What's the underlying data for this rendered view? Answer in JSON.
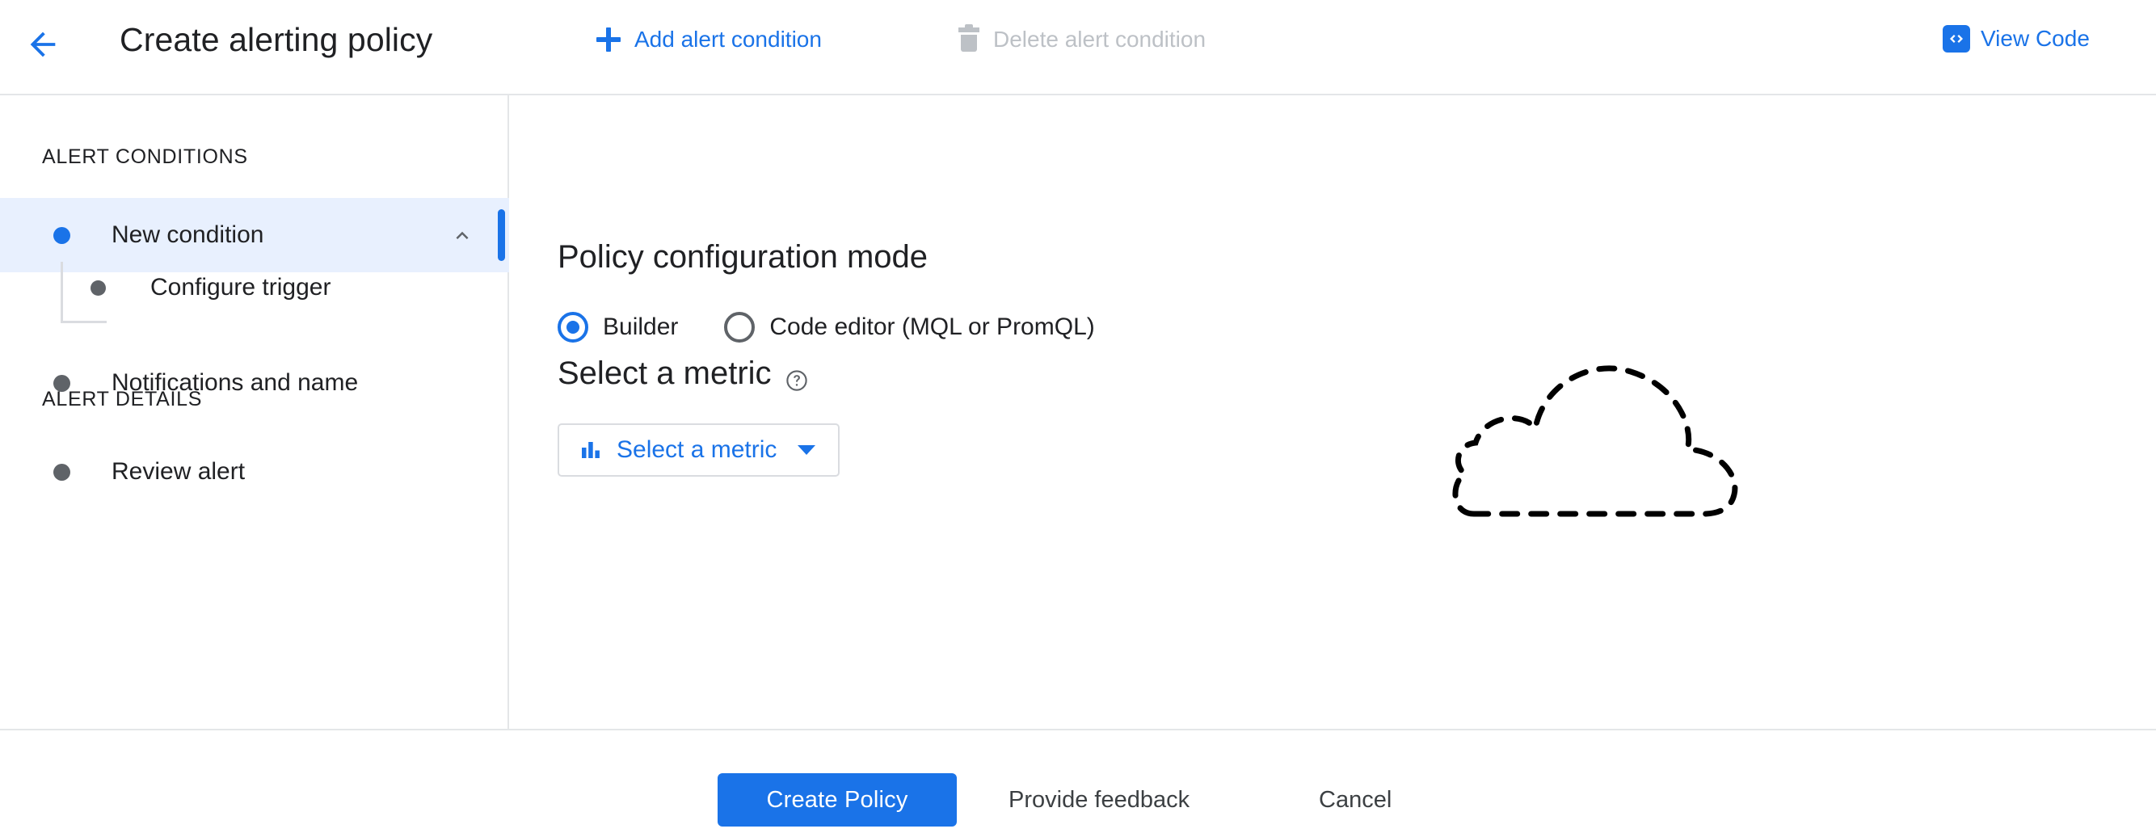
{
  "header": {
    "back_icon": "arrow-left-icon",
    "title": "Create alerting policy",
    "add_condition": {
      "label": "Add alert condition",
      "icon": "plus-icon"
    },
    "delete_condition": {
      "label": "Delete alert condition",
      "icon": "trash-icon",
      "disabled": true
    },
    "view_code": {
      "label": "View Code",
      "icon": "code-brackets-icon"
    },
    "accent_color": "#1a73e8",
    "disabled_color": "#bdc1c6"
  },
  "sidebar": {
    "sections": [
      {
        "label": "ALERT CONDITIONS"
      },
      {
        "label": "ALERT DETAILS"
      }
    ],
    "items": [
      {
        "label": "New condition",
        "selected": true,
        "expanded": true,
        "chevron": "chevron-up-icon"
      },
      {
        "label": "Configure trigger",
        "selected": false
      },
      {
        "label": "Notifications and name",
        "selected": false
      },
      {
        "label": "Review alert",
        "selected": false
      }
    ],
    "selected_bg": "#e8f0fe",
    "selected_dot_color": "#1a73e8",
    "dot_color": "#5f6368"
  },
  "main": {
    "policy_mode": {
      "heading": "Policy configuration mode",
      "options": [
        {
          "label": "Builder",
          "checked": true
        },
        {
          "label": "Code editor (MQL or PromQL)",
          "checked": false
        }
      ]
    },
    "select_metric": {
      "heading": "Select a metric",
      "help_icon": "help-circle-icon",
      "button_label": "Select a metric",
      "button_icon": "bar-chart-icon",
      "caret_icon": "caret-down-icon"
    },
    "illustration": "dashed-cloud-icon"
  },
  "footer": {
    "create_policy": "Create Policy",
    "provide_feedback": "Provide feedback",
    "cancel": "Cancel",
    "primary_color": "#1a73e8"
  }
}
